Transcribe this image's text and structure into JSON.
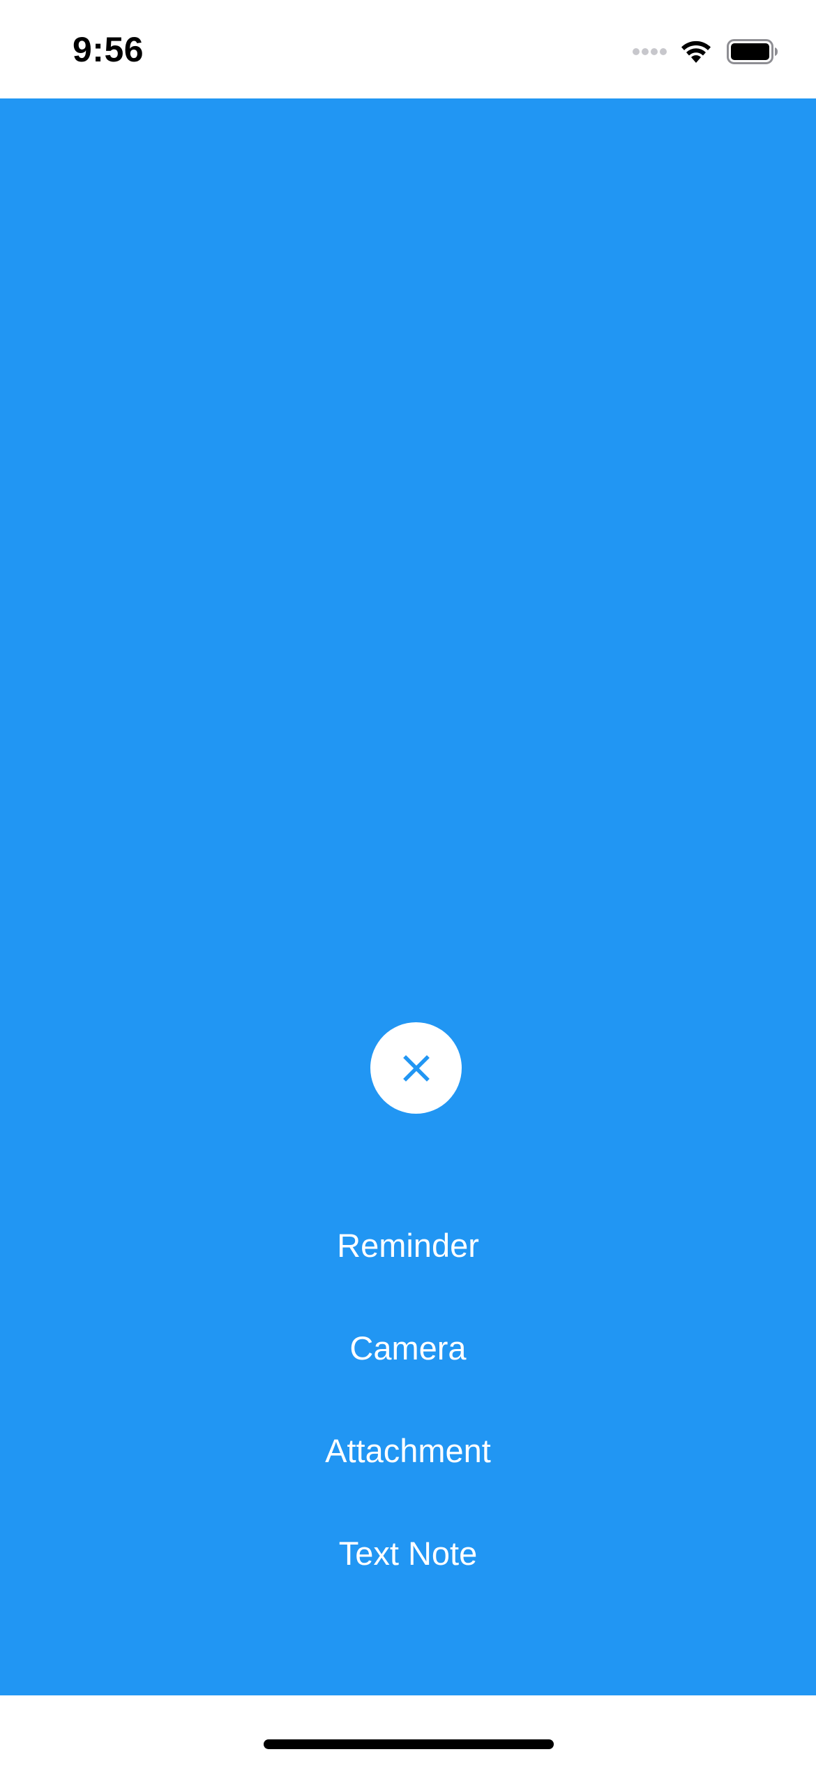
{
  "status_bar": {
    "time": "9:56",
    "icons": [
      "cellular-signal-icon",
      "wifi-icon",
      "battery-icon"
    ]
  },
  "colors": {
    "background_accent": "#2196F3",
    "surface": "#ffffff",
    "foreground_on_accent": "#ffffff"
  },
  "fab": {
    "icon": "close-icon"
  },
  "menu": {
    "items": [
      {
        "label": "Reminder"
      },
      {
        "label": "Camera"
      },
      {
        "label": "Attachment"
      },
      {
        "label": "Text Note"
      }
    ]
  }
}
